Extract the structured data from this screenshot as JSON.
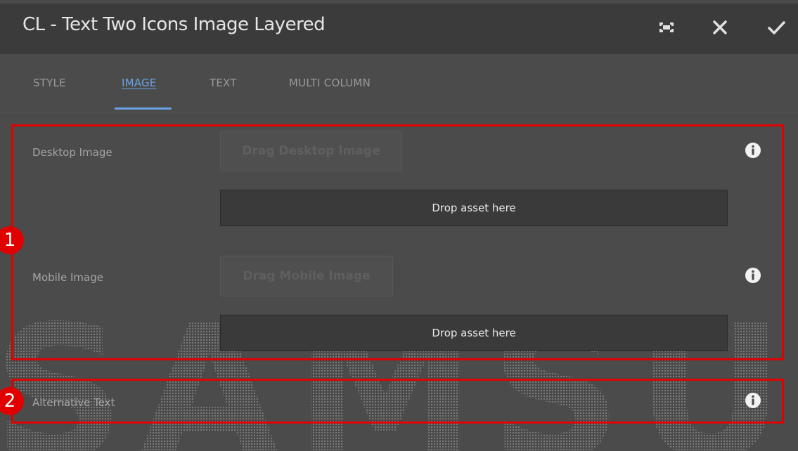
{
  "dialog": {
    "title": "CL - Text Two Icons Image Layered",
    "header_icons": [
      "fullscreen-icon",
      "close-icon",
      "checkmark-icon"
    ]
  },
  "tabs": [
    {
      "label": "STYLE",
      "active": false
    },
    {
      "label": "IMAGE",
      "active": true
    },
    {
      "label": "TEXT",
      "active": false
    },
    {
      "label": "MULTI COLUMN",
      "active": false
    }
  ],
  "fields": {
    "desktop_image": {
      "label": "Desktop Image",
      "button": "Drag Desktop Image",
      "drop": "Drop asset here"
    },
    "mobile_image": {
      "label": "Mobile Image",
      "button": "Drag Mobile Image",
      "drop": "Drop asset here"
    },
    "alt_text": {
      "label": "Alternative Text"
    }
  },
  "annotations": {
    "callout_1": "1",
    "callout_2": "2",
    "color": "#e10000"
  },
  "watermark": "SAMSUNG",
  "colors": {
    "header_bg": "#3b3b3b",
    "body_bg": "#4b4b4b",
    "accent": "#6aa2e6",
    "drop_bg": "#3a3a3a"
  }
}
